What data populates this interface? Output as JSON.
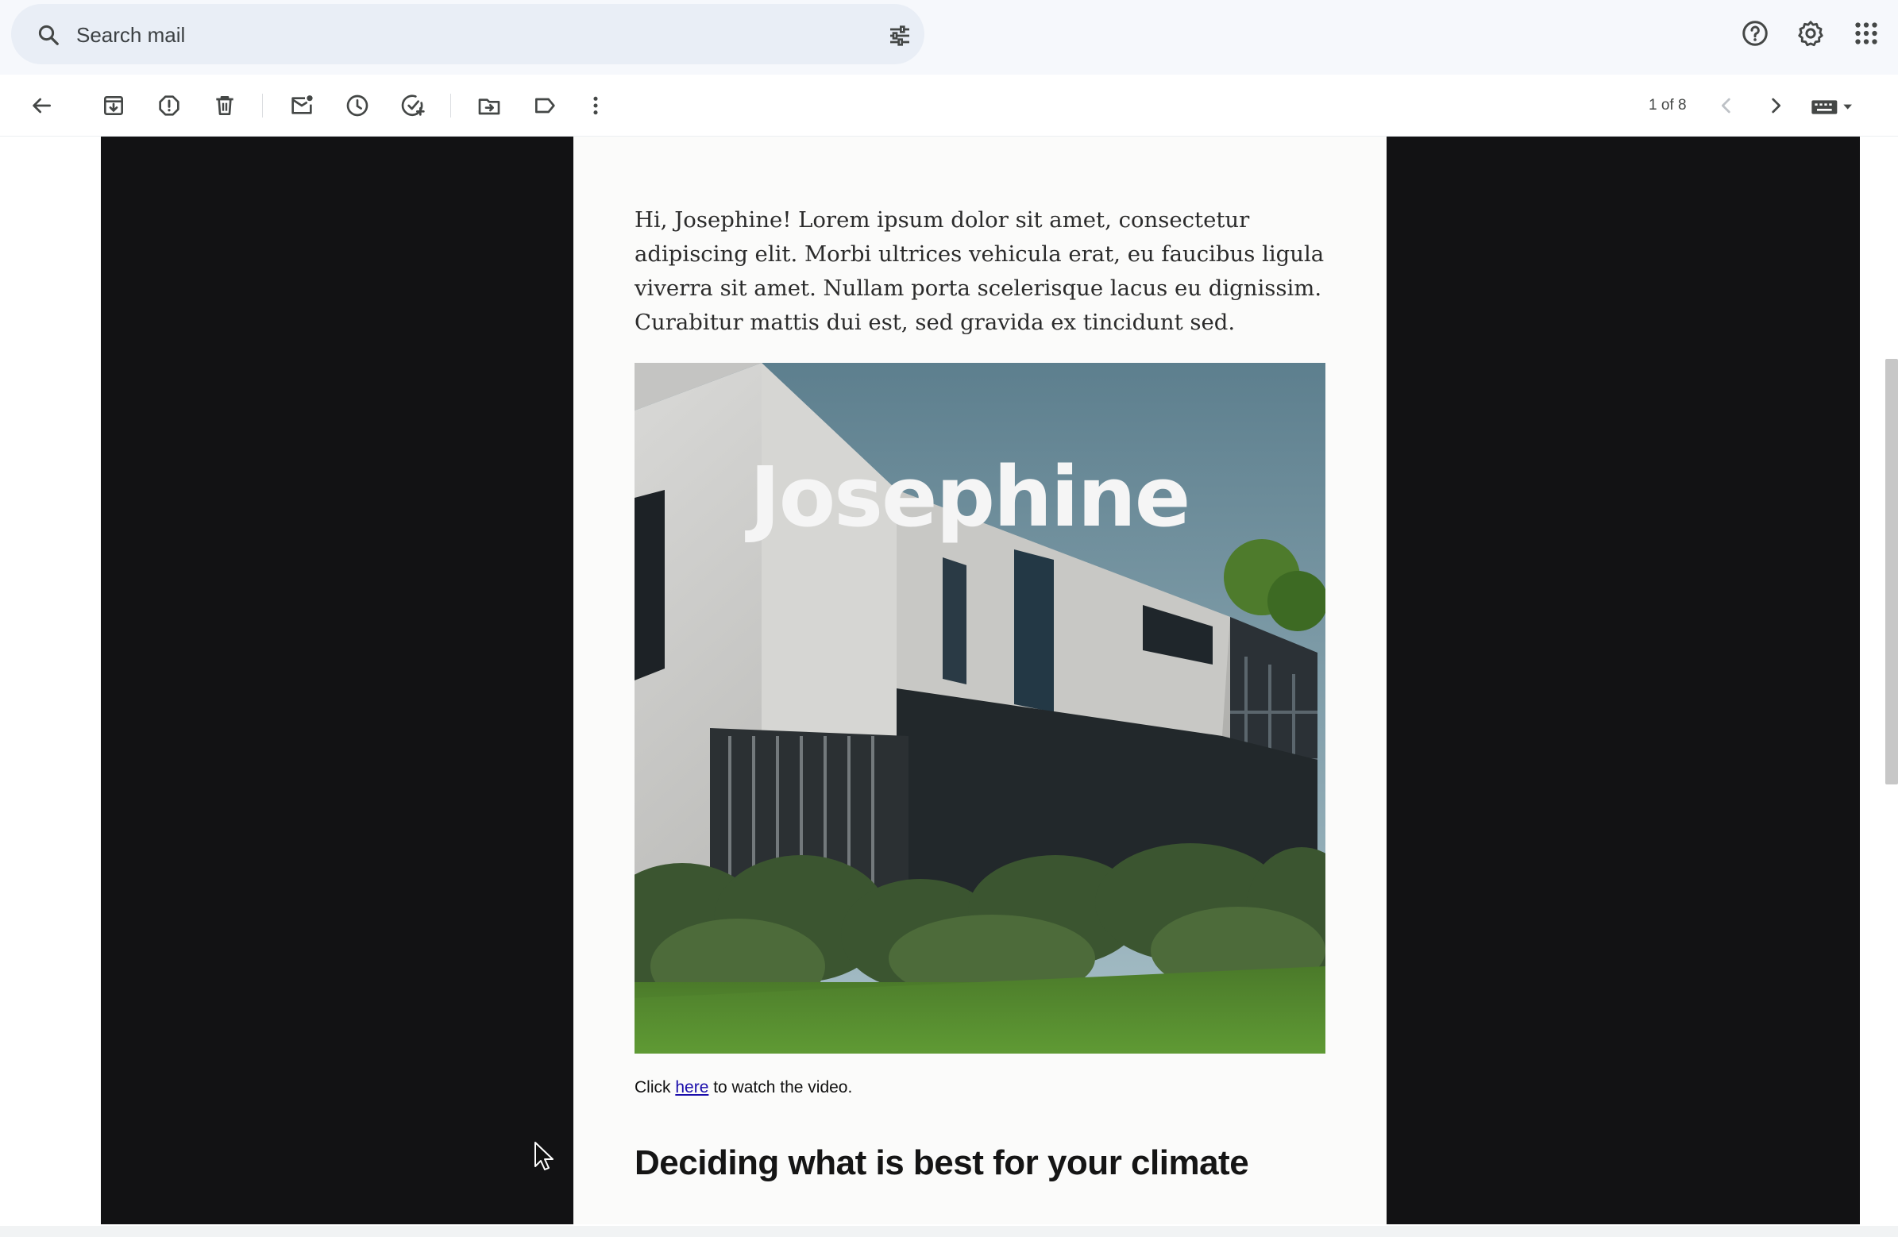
{
  "search": {
    "placeholder": "Search mail",
    "icons": [
      "search-icon",
      "tune-icon"
    ]
  },
  "header_icons": [
    "help-icon",
    "settings-icon",
    "apps-icon"
  ],
  "toolbar": {
    "icons": [
      "back-arrow-icon",
      "archive-icon",
      "report-spam-icon",
      "delete-icon",
      "mark-unread-icon",
      "snooze-icon",
      "add-task-icon",
      "move-to-icon",
      "label-icon",
      "more-vert-icon"
    ],
    "pager": "1 of 8",
    "nav_icons": [
      "chevron-left-icon",
      "chevron-right-icon",
      "keyboard-icon",
      "caret-down-icon"
    ]
  },
  "email": {
    "intro": "Hi, Josephine! Lorem ipsum dolor sit amet, consectetur adipiscing elit. Morbi ultrices vehicula erat, eu faucibus ligula viverra sit amet. Nullam porta scelerisque lacus eu dignissim. Curabitur mattis dui est, sed gravida ex tincidunt sed.",
    "hero_title": "Josephine",
    "cta_prefix": "Click ",
    "cta_link": "here",
    "cta_suffix": " to watch the video.",
    "heading": "Deciding what is best for your climate"
  },
  "colors": {
    "dark_panel": "#121214",
    "paper": "#fbfbfa",
    "link": "#1a0dab",
    "search_bg": "#e9eef6"
  }
}
